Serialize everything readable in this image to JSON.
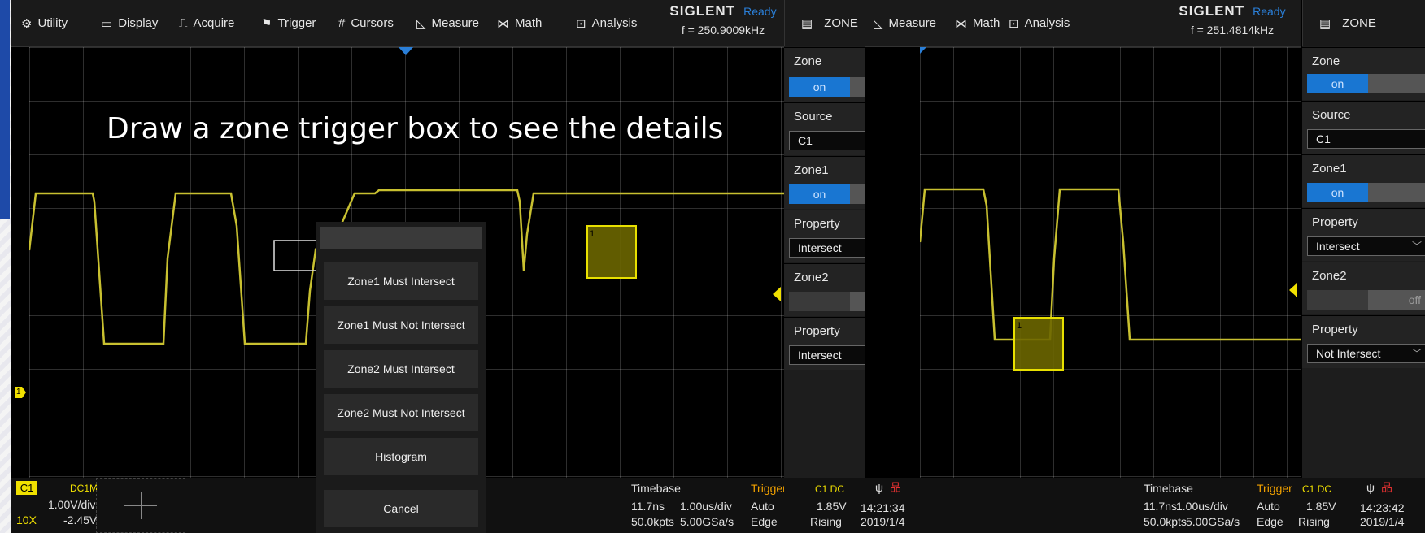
{
  "left_scope": {
    "toolbar": {
      "items": [
        {
          "icon": "⚙",
          "label": "Utility"
        },
        {
          "icon": "▭",
          "label": "Display"
        },
        {
          "icon": "⎍",
          "label": "Acquire"
        },
        {
          "icon": "⚑",
          "label": "Trigger"
        },
        {
          "icon": "#",
          "label": "Cursors"
        },
        {
          "icon": "◺",
          "label": "Measure"
        },
        {
          "icon": "⋈",
          "label": "Math"
        },
        {
          "icon": "⊡",
          "label": "Analysis"
        }
      ],
      "brand": "SIGLENT",
      "status": "Ready",
      "freq": "f = 250.9009kHz"
    },
    "panel": {
      "title": "ZONE",
      "zone_label": "Zone",
      "zone_state": "on",
      "source_label": "Source",
      "source_value": "C1",
      "zone1_label": "Zone1",
      "zone1_state": "on",
      "property1_label": "Property",
      "property1_value": "Intersect",
      "zone2_label": "Zone2",
      "zone2_state": "off",
      "property2_label": "Property",
      "property2_value": "Intersect"
    },
    "overlay_text": "Draw a zone trigger box to see the details",
    "menu": {
      "items": [
        "Zone1 Must Intersect",
        "Zone1 Must Not Intersect",
        "Zone2 Must Intersect",
        "Zone2 Must Not Intersect",
        "Histogram"
      ],
      "cancel": "Cancel"
    },
    "zone_box_label": "1",
    "trigger_marker": "T",
    "channel_marker": "1",
    "status": {
      "channel": "C1",
      "coupling": "DC1M",
      "vdiv": "1.00V/div",
      "probe": "10X",
      "offset": "-2.45V",
      "timebase_label": "Timebase",
      "delay": "11.7ns",
      "tdiv": "1.00us/div",
      "points": "50.0kpts",
      "srate": "5.00GSa/s",
      "trigger_label": "Trigger",
      "trig_src": "C1 DC",
      "trig_mode": "Auto",
      "trig_level": "1.85V",
      "trig_type": "Edge",
      "trig_slope": "Rising",
      "time": "14:21:34",
      "date": "2019/1/4"
    }
  },
  "right_scope": {
    "toolbar": {
      "items": [
        {
          "icon": "◺",
          "label": "Measure"
        },
        {
          "icon": "⋈",
          "label": "Math"
        },
        {
          "icon": "⊡",
          "label": "Analysis"
        }
      ],
      "brand": "SIGLENT",
      "status": "Ready",
      "freq": "f = 251.4814kHz"
    },
    "panel": {
      "title": "ZONE",
      "zone_label": "Zone",
      "zone_state": "on",
      "source_label": "Source",
      "source_value": "C1",
      "zone1_label": "Zone1",
      "zone1_state": "on",
      "property1_label": "Property",
      "property1_value": "Intersect",
      "zone2_label": "Zone2",
      "zone2_state": "off",
      "property2_label": "Property",
      "property2_value": "Not Intersect"
    },
    "zone_box_label": "1",
    "status": {
      "timebase_label": "Timebase",
      "delay": "11.7ns",
      "tdiv": "1.00us/div",
      "points": "50.0kpts",
      "srate": "5.00GSa/s",
      "trigger_label": "Trigger",
      "trig_src": "C1 DC",
      "trig_mode": "Auto",
      "trig_level": "1.85V",
      "trig_type": "Edge",
      "trig_slope": "Rising",
      "time": "14:23:42",
      "date": "2019/1/4"
    }
  },
  "colors": {
    "trace": "#c8c030",
    "zone_fill": "#6b6600",
    "zone_border": "#e8e000",
    "accent": "#1976d2",
    "ready": "#2a7fd8",
    "trigger_orange": "#f0a000",
    "channel_yellow": "#f0e000"
  }
}
